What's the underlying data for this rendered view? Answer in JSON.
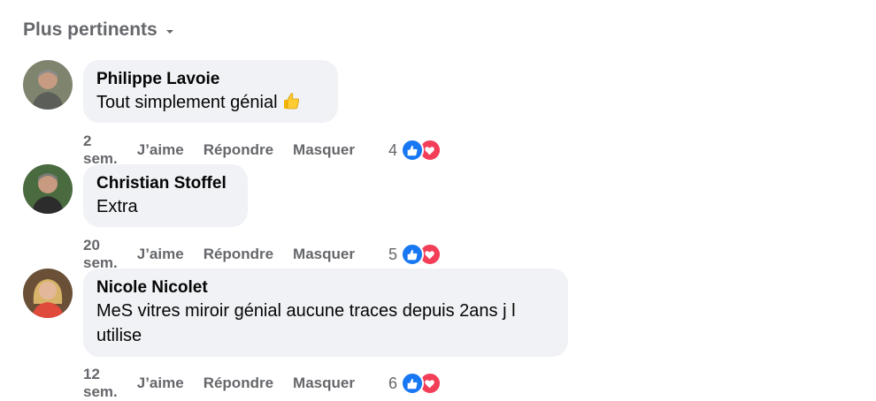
{
  "sort": {
    "label": "Plus pertinents"
  },
  "comments": [
    {
      "author": "Philippe Lavoie",
      "text": "Tout simplement génial",
      "has_thumb_emoji": true,
      "time": "2 sem.",
      "like_label": "J’aime",
      "reply_label": "Répondre",
      "hide_label": "Masquer",
      "reaction_count": "4",
      "avatar_bg": "#6b6f5e"
    },
    {
      "author": "Christian Stoffel",
      "text": "Extra",
      "has_thumb_emoji": false,
      "time": "20 sem.",
      "like_label": "J’aime",
      "reply_label": "Répondre",
      "hide_label": "Masquer",
      "reaction_count": "5",
      "avatar_bg": "#4f6a45"
    },
    {
      "author": "Nicole Nicolet",
      "text": "MeS vitres miroir génial aucune traces depuis 2ans j l utilise",
      "has_thumb_emoji": false,
      "time": "12 sem.",
      "like_label": "J’aime",
      "reply_label": "Répondre",
      "hide_label": "Masquer",
      "reaction_count": "6",
      "avatar_bg": "#7a5a3f"
    }
  ],
  "colors": {
    "like": "#1877f2",
    "love": "#f33e58",
    "bubble": "#f0f2f5",
    "meta": "#65676b"
  }
}
